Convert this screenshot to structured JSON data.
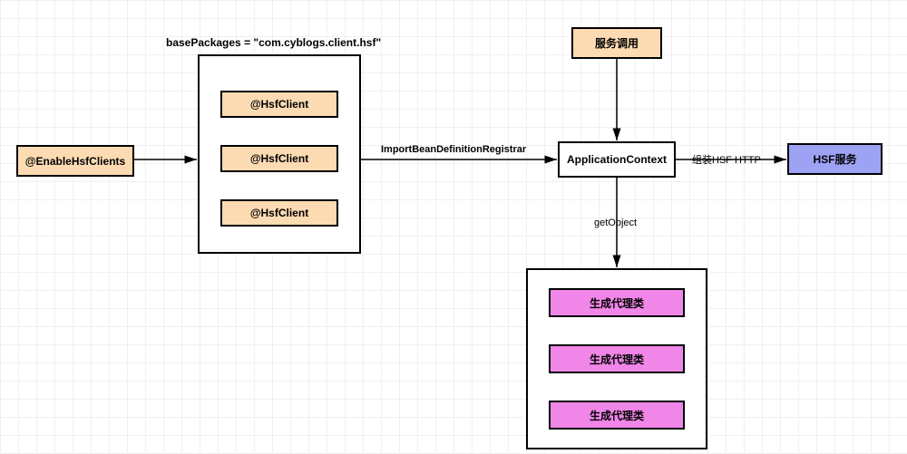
{
  "nodes": {
    "enable": "@EnableHsfClients",
    "packageLabel": "basePackages = \"com.cyblogs.client.hsf\"",
    "hsf1": "@HsfClient",
    "hsf2": "@HsfClient",
    "hsf3": "@HsfClient",
    "appctx": "ApplicationContext",
    "serviceCall": "服务调用",
    "hsfService": "HSF服务",
    "proxy1": "生成代理类",
    "proxy2": "生成代理类",
    "proxy3": "生成代理类"
  },
  "edges": {
    "importReg": "ImportBeanDefinitionRegistrar",
    "assemble": "组装HSF HTTP",
    "getObject": "getObject"
  }
}
